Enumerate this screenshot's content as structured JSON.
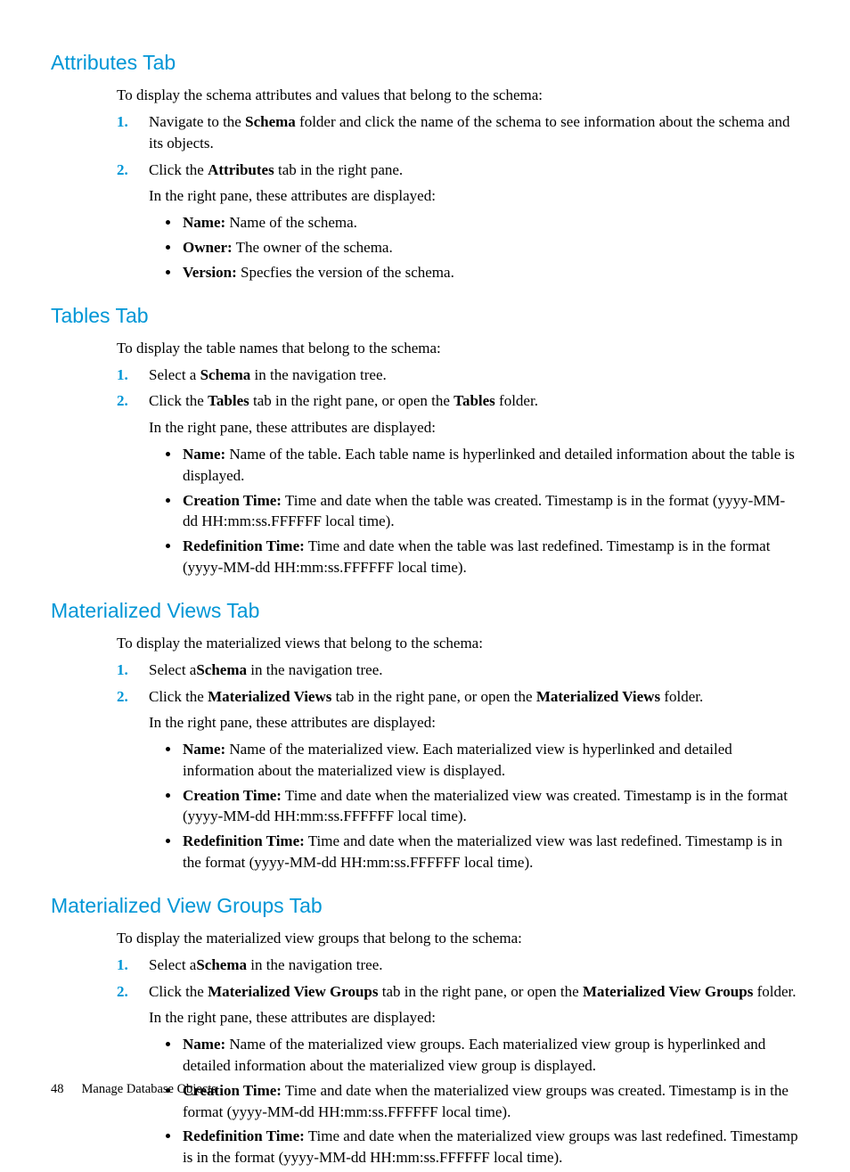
{
  "page": {
    "number": "48",
    "chapter": "Manage Database Objects"
  },
  "sections": [
    {
      "heading": "Attributes Tab",
      "intro": "To display the schema attributes and values that belong to the schema:",
      "steps": [
        {
          "num": "1.",
          "segs": [
            {
              "t": "Navigate to the "
            },
            {
              "b": "Schema"
            },
            {
              "t": " folder and click the name of the schema to see information about the schema and its objects."
            }
          ]
        },
        {
          "num": "2.",
          "segs": [
            {
              "t": "Click the "
            },
            {
              "b": "Attributes"
            },
            {
              "t": " tab in the right pane."
            }
          ],
          "sub_intro": "In the right pane, these attributes are displayed:",
          "bullets": [
            [
              {
                "b": "Name:"
              },
              {
                "t": " Name of the schema."
              }
            ],
            [
              {
                "b": "Owner:"
              },
              {
                "t": " The owner of the schema."
              }
            ],
            [
              {
                "b": "Version:"
              },
              {
                "t": " Specfies the version of the schema."
              }
            ]
          ]
        }
      ]
    },
    {
      "heading": "Tables Tab",
      "intro": "To display the table names that belong to the schema:",
      "steps": [
        {
          "num": "1.",
          "segs": [
            {
              "t": "Select a "
            },
            {
              "b": "Schema"
            },
            {
              "t": " in the navigation tree."
            }
          ]
        },
        {
          "num": "2.",
          "segs": [
            {
              "t": "Click the "
            },
            {
              "b": "Tables"
            },
            {
              "t": " tab in the right pane, or open the "
            },
            {
              "b": "Tables"
            },
            {
              "t": " folder."
            }
          ],
          "sub_intro": "In the right pane, these attributes are displayed:",
          "bullets": [
            [
              {
                "b": "Name:"
              },
              {
                "t": " Name of the table. Each table name is hyperlinked and detailed information about the table is displayed."
              }
            ],
            [
              {
                "b": "Creation Time:"
              },
              {
                "t": " Time and date when the table was created. Timestamp is in the format (yyyy-MM-dd HH:mm:ss.FFFFFF local time)."
              }
            ],
            [
              {
                "b": "Redefinition Time:"
              },
              {
                "t": " Time and date when the table was last redefined. Timestamp is in the format (yyyy-MM-dd HH:mm:ss.FFFFFF local time)."
              }
            ]
          ]
        }
      ]
    },
    {
      "heading": "Materialized Views Tab",
      "intro": "To display the materialized views that belong to the schema:",
      "steps": [
        {
          "num": "1.",
          "segs": [
            {
              "t": "Select a"
            },
            {
              "b": "Schema"
            },
            {
              "t": " in the navigation tree."
            }
          ]
        },
        {
          "num": "2.",
          "segs": [
            {
              "t": "Click the "
            },
            {
              "b": "Materialized Views"
            },
            {
              "t": " tab in the right pane, or open the "
            },
            {
              "b": "Materialized Views"
            },
            {
              "t": " folder."
            }
          ],
          "sub_intro": "In the right pane, these attributes are displayed:",
          "bullets": [
            [
              {
                "b": "Name:"
              },
              {
                "t": " Name of the materialized view. Each materialized view is hyperlinked and detailed information about the materialized view is displayed."
              }
            ],
            [
              {
                "b": "Creation Time:"
              },
              {
                "t": " Time and date when the materialized view was created. Timestamp is in the format (yyyy-MM-dd HH:mm:ss.FFFFFF local time)."
              }
            ],
            [
              {
                "b": "Redefinition Time:"
              },
              {
                "t": " Time and date when the materialized view was last redefined. Timestamp is in the format (yyyy-MM-dd HH:mm:ss.FFFFFF local time)."
              }
            ]
          ]
        }
      ]
    },
    {
      "heading": "Materialized View Groups Tab",
      "intro": "To display the materialized view groups that belong to the schema:",
      "steps": [
        {
          "num": "1.",
          "segs": [
            {
              "t": "Select a"
            },
            {
              "b": "Schema"
            },
            {
              "t": " in the navigation tree."
            }
          ]
        },
        {
          "num": "2.",
          "segs": [
            {
              "t": "Click the "
            },
            {
              "b": "Materialized View Groups"
            },
            {
              "t": " tab in the right pane, or open the "
            },
            {
              "b": "Materialized View Groups"
            },
            {
              "t": " folder."
            }
          ],
          "sub_intro": "In the right pane, these attributes are displayed:",
          "bullets": [
            [
              {
                "b": "Name:"
              },
              {
                "t": " Name of the materialized view groups. Each materialized view group is hyperlinked and detailed information about the materialized view group is displayed."
              }
            ],
            [
              {
                "b": "Creation Time:"
              },
              {
                "t": " Time and date when the materialized view groups was created. Timestamp is in the format (yyyy-MM-dd HH:mm:ss.FFFFFF local time)."
              }
            ],
            [
              {
                "b": "Redefinition Time:"
              },
              {
                "t": " Time and date when the materialized view groups was last redefined. Timestamp is in the format (yyyy-MM-dd HH:mm:ss.FFFFFF local time)."
              }
            ]
          ]
        }
      ]
    }
  ]
}
